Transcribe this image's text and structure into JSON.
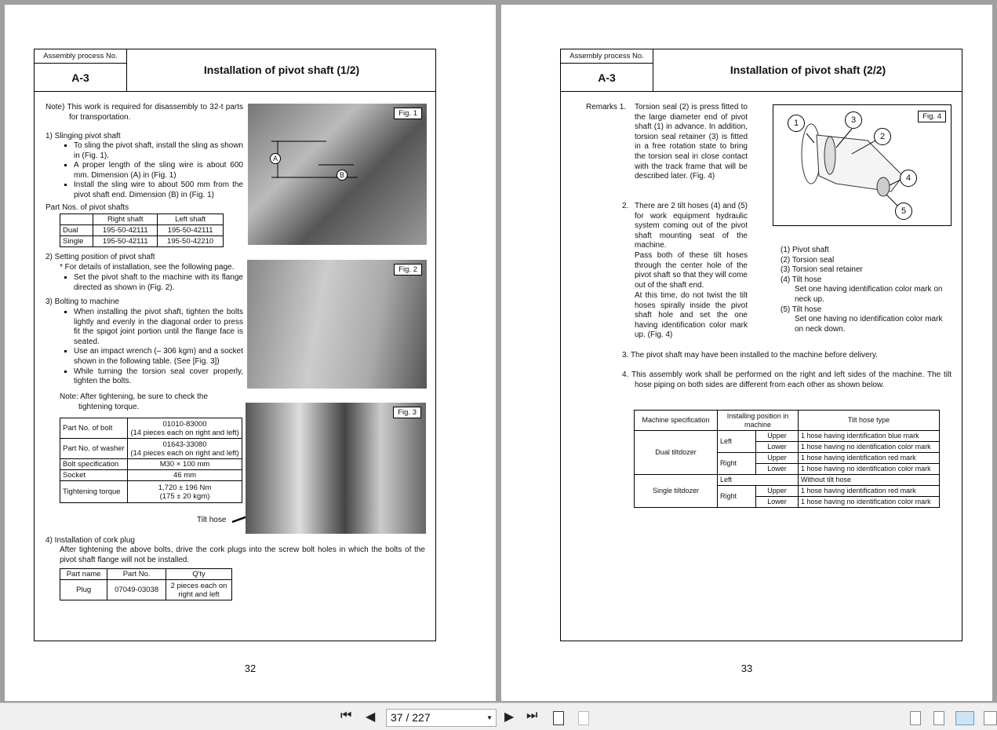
{
  "pages": [
    {
      "number": "32",
      "header": {
        "label": "Assembly process No.",
        "id": "A-3",
        "title": "Installation of pivot shaft (1/2)"
      },
      "note": "Note) This work is required for disassembly to 32-t parts for transportation.",
      "s1": {
        "title": "1)  Slinging pivot shaft",
        "bullets": [
          "To sling the pivot shaft, install the sling as shown in (Fig. 1).",
          "A proper length of the sling wire is about 600 mm.  Dimension (A) in (Fig. 1)",
          "Install the sling wire to about 500 mm from the pivot shaft end.  Dimension (B) in (Fig. 1)"
        ]
      },
      "parts_caption": "Part Nos. of pivot shafts",
      "parts_table": {
        "headers": [
          "",
          "Right shaft",
          "Left shaft"
        ],
        "rows": [
          [
            "Dual",
            "195-50-42111",
            "195-50-42111"
          ],
          [
            "Single",
            "195-50-42111",
            "195-50-42210"
          ]
        ]
      },
      "s2": {
        "title": "2)  Setting position of pivot shaft",
        "note": "* For details of installation, see the following page.",
        "bullets": [
          "Set the pivot shaft to the machine with its flange directed as shown in (Fig. 2)."
        ]
      },
      "s3": {
        "title": "3)  Bolting to machine",
        "bullets": [
          "When installing the pivot shaft, tighten the bolts lightly and evenly in the diagonal order to press fit the spigot joint portion until the flange face is seated.",
          "Use an impact wrench (– 306 kgm) and a socket shown in the following table. (See [Fig. 3])",
          "While turning the torsion seal cover properly, tighten the bolts."
        ],
        "note": "Note: After tightening, be sure to check the tightening torque."
      },
      "bolt_table": [
        [
          "Part No. of bolt",
          "01010-83000",
          "(14 pieces each on right and left)"
        ],
        [
          "Part No. of washer",
          "01643-33080",
          "(14 pieces each on right and left)"
        ],
        [
          "Bolt specification",
          "M30 × 100 mm",
          ""
        ],
        [
          "Socket",
          "46 mm",
          ""
        ],
        [
          "Tightening torque",
          "1,720 ± 196 Nm",
          "(175 ± 20 kgm)"
        ]
      ],
      "figs": {
        "fig1": "Fig. 1",
        "fig2": "Fig. 2",
        "fig3": "Fig. 3",
        "dimA": "A",
        "dimB": "B",
        "tilt_hose": "Tilt hose"
      },
      "s4": {
        "title": "4)  Installation of cork plug",
        "text": "After tightening the above bolts, drive the cork plugs into the screw bolt holes in which the bolts of the pivot shaft flange will not be installed."
      },
      "plug_table": {
        "headers": [
          "Part name",
          "Part No.",
          "Q'ty"
        ],
        "row": [
          "Plug",
          "07049-03038",
          "2 pieces each on right and left"
        ]
      }
    },
    {
      "number": "33",
      "header": {
        "label": "Assembly process No.",
        "id": "A-3",
        "title": "Installation of pivot shaft (2/2)"
      },
      "remarks_label": "Remarks 1.",
      "r1": "Torsion seal (2) is press fitted to the large diameter end of pivot shaft (1) in advance. In addition, torsion seal retainer (3) is fitted in a free rotation state to bring the torsion seal in close contact with the track frame that will be described later. (Fig. 4)",
      "r2_num": "2.",
      "r2a": "There are 2 tilt hoses (4) and (5) for work equipment hydraulic system coming out of the pivot shaft mounting seat of the machine.",
      "r2b": "Pass both of these tilt hoses through the center hole of the pivot shaft so that they will come out of the shaft end.",
      "r2c": "At this time, do not twist the tilt hoses spirally inside the pivot shaft hole and set the one having identification color mark up. (Fig. 4)",
      "r3": "3.  The pivot shaft may have been installed to the machine before delivery.",
      "r4": "4.  This assembly work shall be performed on the right and left sides of the machine. The tilt hose piping on both sides are different from each other as shown below.",
      "fig4": "Fig. 4",
      "callouts": [
        "1",
        "2",
        "3",
        "4",
        "5"
      ],
      "legend": [
        {
          "n": "(1)",
          "t": "Pivot shaft"
        },
        {
          "n": "(2)",
          "t": "Torsion seal"
        },
        {
          "n": "(3)",
          "t": "Torsion seal retainer"
        },
        {
          "n": "(4)",
          "t": "Tilt hose",
          "d": "Set one having identification color mark on neck up."
        },
        {
          "n": "(5)",
          "t": "Tilt hose",
          "d": "Set one having no identification color mark on neck down."
        }
      ],
      "hose_table": {
        "headers": [
          "Machine specification",
          "Installing position in machine",
          "Tilt hose type"
        ],
        "dual": "Dual tiltdozer",
        "single": "Single tiltdozer",
        "left": "Left",
        "right": "Right",
        "upper": "Upper",
        "lower": "Lower",
        "d_lu": "1 hose having identification blue mark",
        "d_ll": "1 hose having no identification color mark",
        "d_ru": "1 hose having identification red mark",
        "d_rl": "1 hose having no identification color mark",
        "s_l": "Without tilt hose",
        "s_ru": "1 hose having identification red mark",
        "s_rl": "1 hose having no identification color mark"
      }
    }
  ],
  "toolbar": {
    "page_value": "37 / 227"
  }
}
